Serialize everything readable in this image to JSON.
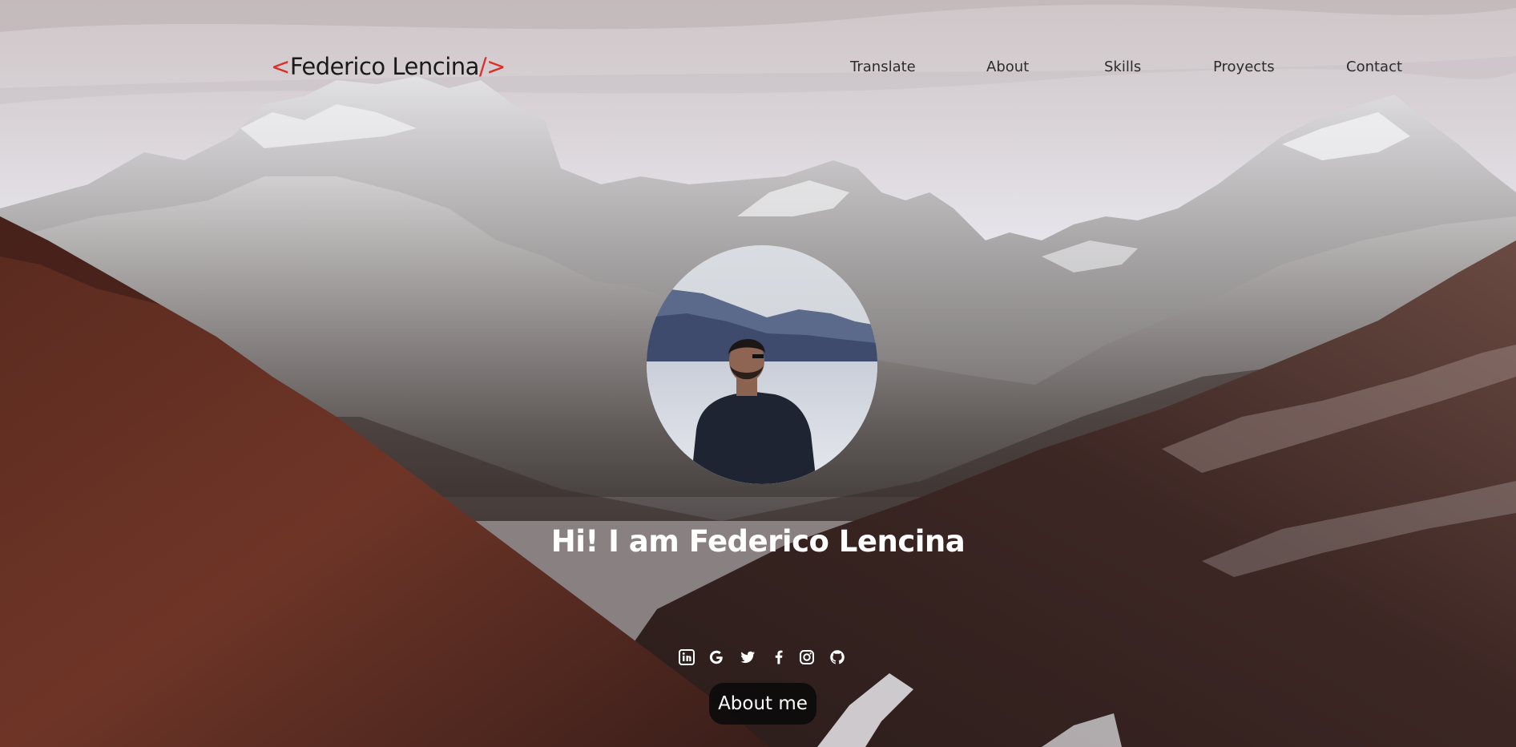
{
  "header": {
    "brand_open": "<",
    "brand_name": "Federico Lencina",
    "brand_close": "/>",
    "nav": [
      {
        "label": "Translate"
      },
      {
        "label": "About"
      },
      {
        "label": "Skills"
      },
      {
        "label": "Proyects"
      },
      {
        "label": "Contact"
      }
    ]
  },
  "hero": {
    "headline": "Hi! I am Federico Lencina",
    "cta_label": "About me"
  },
  "social": [
    {
      "icon": "linkedin-icon"
    },
    {
      "icon": "google-icon"
    },
    {
      "icon": "twitter-icon"
    },
    {
      "icon": "facebook-icon"
    },
    {
      "icon": "instagram-icon"
    },
    {
      "icon": "github-icon"
    }
  ],
  "colors": {
    "accent": "#d9302a",
    "text_dark": "#1a1a1a",
    "headline": "#ffffff",
    "button_bg": "#0a0a0a"
  }
}
